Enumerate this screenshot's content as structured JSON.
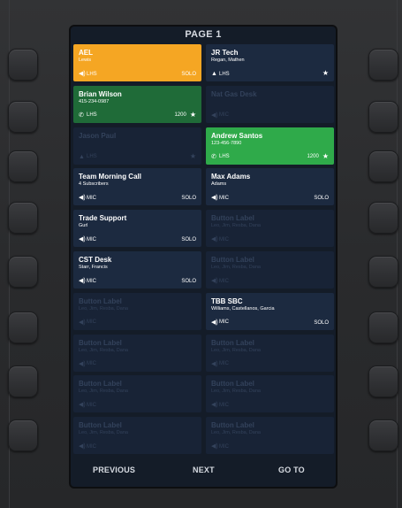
{
  "page_title": "PAGE 1",
  "tiles": [
    {
      "title": "AEL",
      "sub": "Lewis",
      "foot_icon": "speaker",
      "foot": "LHS",
      "right": "SOLO",
      "star": false,
      "style": "orange"
    },
    {
      "title": "JR Tech",
      "sub": "Regan, Mathen",
      "foot_icon": "bell",
      "foot": "LHS",
      "right": "",
      "star": true,
      "style": "dark"
    },
    {
      "title": "Brian Wilson",
      "sub": "415-234-0987",
      "foot_icon": "phone",
      "foot": "LHS",
      "right": "1200",
      "star": true,
      "style": "darkgreen"
    },
    {
      "title": "Nat Gas Desk",
      "sub": "",
      "foot_icon": "speaker",
      "foot": "MIC",
      "right": "",
      "star": false,
      "style": "dim"
    },
    {
      "title": "Jason Paul",
      "sub": "",
      "foot_icon": "bell",
      "foot": "LHS",
      "right": "",
      "star": true,
      "style": "dim"
    },
    {
      "title": "Andrew Santos",
      "sub": "123-456-7890",
      "foot_icon": "phone",
      "foot": "LHS",
      "right": "1200",
      "star": true,
      "style": "green"
    },
    {
      "title": "Team Morning Call",
      "sub": "4 Subscribers",
      "foot_icon": "speaker",
      "foot": "MIC",
      "right": "SOLO",
      "star": false,
      "style": "dark"
    },
    {
      "title": "Max Adams",
      "sub": "Adams",
      "foot_icon": "speaker",
      "foot": "MIC",
      "right": "SOLO",
      "star": false,
      "style": "dark"
    },
    {
      "title": "Trade Support",
      "sub": "Gurl",
      "foot_icon": "speaker",
      "foot": "MIC",
      "right": "SOLO",
      "star": false,
      "style": "dark"
    },
    {
      "title": "Button Label",
      "sub": "Leo, Jim, Resba, Dana",
      "foot_icon": "speaker",
      "foot": "MIC",
      "right": "",
      "star": false,
      "style": "dim"
    },
    {
      "title": "CST Desk",
      "sub": "Starr, Francis",
      "foot_icon": "speaker",
      "foot": "MIC",
      "right": "SOLO",
      "star": false,
      "style": "dark"
    },
    {
      "title": "Button Label",
      "sub": "Leo, Jim, Resba, Dana",
      "foot_icon": "speaker",
      "foot": "MIC",
      "right": "",
      "star": false,
      "style": "dim"
    },
    {
      "title": "Button Label",
      "sub": "Leo, Jim, Resba, Dana",
      "foot_icon": "speaker",
      "foot": "MIC",
      "right": "",
      "star": false,
      "style": "dim"
    },
    {
      "title": "TBB SBC",
      "sub": "Williams, Castellanos, Garcia",
      "foot_icon": "speaker",
      "foot": "MIC",
      "right": "SOLO",
      "star": false,
      "style": "dark"
    },
    {
      "title": "Button Label",
      "sub": "Leo, Jim, Resba, Dana",
      "foot_icon": "speaker",
      "foot": "MIC",
      "right": "",
      "star": false,
      "style": "dim"
    },
    {
      "title": "Button Label",
      "sub": "Leo, Jim, Resba, Dana",
      "foot_icon": "speaker",
      "foot": "MIC",
      "right": "",
      "star": false,
      "style": "dim"
    },
    {
      "title": "Button Label",
      "sub": "Leo, Jim, Resba, Dana",
      "foot_icon": "speaker",
      "foot": "MIC",
      "right": "",
      "star": false,
      "style": "dim"
    },
    {
      "title": "Button Label",
      "sub": "Leo, Jim, Resba, Dana",
      "foot_icon": "speaker",
      "foot": "MIC",
      "right": "",
      "star": false,
      "style": "dim"
    },
    {
      "title": "Button Label",
      "sub": "Leo, Jim, Resba, Dana",
      "foot_icon": "speaker",
      "foot": "MIC",
      "right": "",
      "star": false,
      "style": "dim"
    },
    {
      "title": "Button Label",
      "sub": "Leo, Jim, Resba, Dana",
      "foot_icon": "speaker",
      "foot": "MIC",
      "right": "",
      "star": false,
      "style": "dim"
    }
  ],
  "nav": {
    "previous": "PREVIOUS",
    "next": "NEXT",
    "goto": "GO TO"
  },
  "colors": {
    "orange": "#f5a623",
    "green": "#2faa4a",
    "dark_green": "#1f6b38",
    "tile": "#1c2a40",
    "screen": "#141c28"
  }
}
